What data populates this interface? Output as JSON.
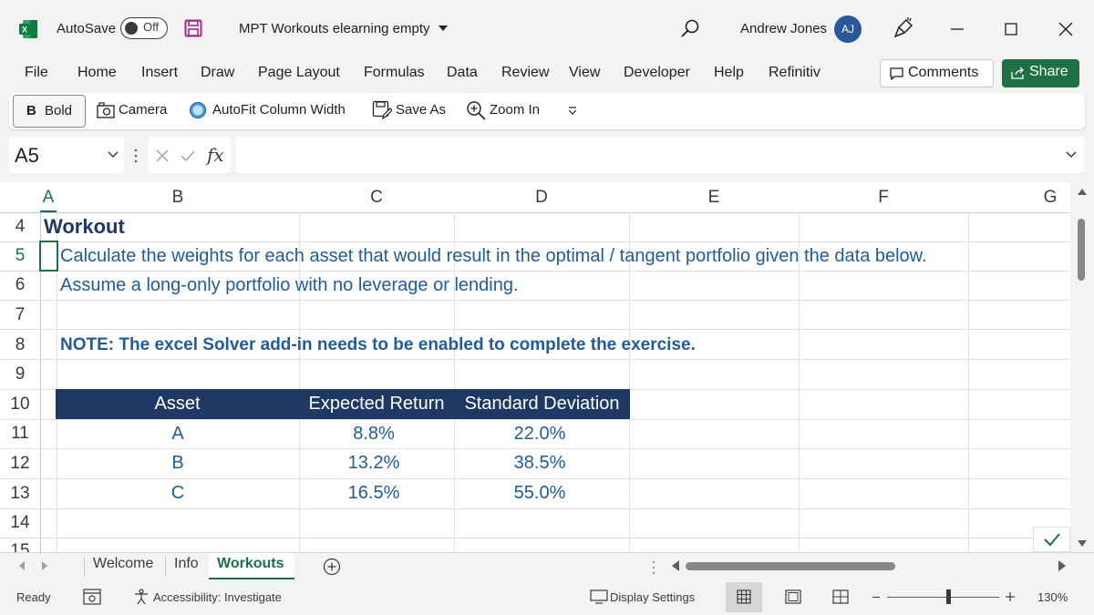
{
  "titlebar": {
    "autosave_label": "AutoSave",
    "autosave_state": "Off",
    "document_title": "MPT Workouts elearning empty",
    "user_name": "Andrew Jones",
    "user_initials": "AJ"
  },
  "menu": {
    "items": [
      "File",
      "Home",
      "Insert",
      "Draw",
      "Page Layout",
      "Formulas",
      "Data",
      "Review",
      "View",
      "Developer",
      "Help",
      "Refinitiv"
    ],
    "comments_label": "Comments",
    "share_label": "Share"
  },
  "quick_access": {
    "bold_label": "Bold",
    "bold_glyph": "B",
    "camera_label": "Camera",
    "autofit_label": "AutoFit Column Width",
    "saveas_label": "Save As",
    "zoomin_label": "Zoom In"
  },
  "formula_bar": {
    "name_box": "A5",
    "fx_symbol": "fx",
    "formula_value": ""
  },
  "columns": [
    "A",
    "B",
    "C",
    "D",
    "E",
    "F",
    "G"
  ],
  "rows": [
    "4",
    "5",
    "6",
    "7",
    "8",
    "9",
    "10",
    "11",
    "12",
    "13",
    "14",
    "15"
  ],
  "sheet": {
    "heading": "Workout",
    "line1": "Calculate the weights for each asset that would result in the optimal / tangent portfolio given the data below.",
    "line2": "Assume a long-only portfolio with no leverage or lending.",
    "note": "NOTE: The excel Solver add-in needs to be enabled to complete the exercise.",
    "table": {
      "headers": [
        "Asset",
        "Expected Return",
        "Standard Deviation"
      ],
      "rows": [
        [
          "A",
          "8.8%",
          "22.0%"
        ],
        [
          "B",
          "13.2%",
          "38.5%"
        ],
        [
          "C",
          "16.5%",
          "55.0%"
        ]
      ]
    }
  },
  "sheet_tabs": [
    "Welcome",
    "Info",
    "Workouts"
  ],
  "status": {
    "ready": "Ready",
    "accessibility": "Accessibility: Investigate",
    "display_settings": "Display Settings",
    "zoom": "130%"
  },
  "colors": {
    "excel_green": "#1e7145",
    "table_header": "#1f3864",
    "text_blue": "#1f5c99",
    "avatar": "#2b579a"
  }
}
